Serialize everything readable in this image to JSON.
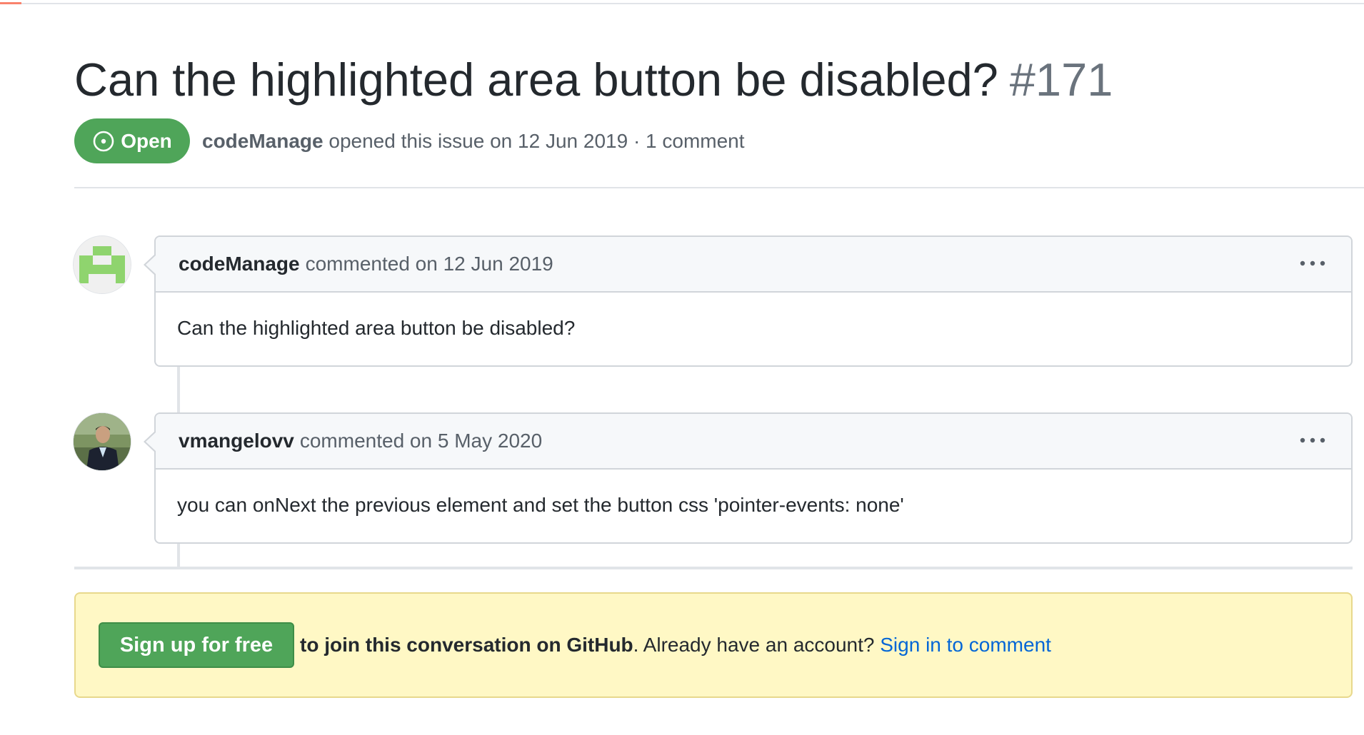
{
  "issue": {
    "title": "Can the highlighted area button be disabled?",
    "number": "#171",
    "state": "Open",
    "author": "codeManage",
    "meta": " opened this issue on 12 Jun 2019 · 1 comment"
  },
  "comments": [
    {
      "author": "codeManage",
      "action": "commented on 12 Jun 2019",
      "body": "Can the highlighted area button be disabled?",
      "avatar": "identicon-avatar"
    },
    {
      "author": "vmangelovv",
      "action": "commented on 5 May 2020",
      "body": "you can onNext the previous element and set the button css 'pointer-events: none'",
      "avatar": "photo-avatar"
    }
  ],
  "signup": {
    "button_label": "Sign up for free",
    "join_text": "to join this conversation on GitHub",
    "account_text": ". Already have an account? ",
    "signin_link": "Sign in to comment"
  },
  "colors": {
    "open_badge": "#4fa559",
    "link": "#0366d6",
    "identicon": "#8fd46e"
  },
  "icons": {
    "state": "issue-opened-icon",
    "menu": "kebab-horizontal-icon"
  }
}
